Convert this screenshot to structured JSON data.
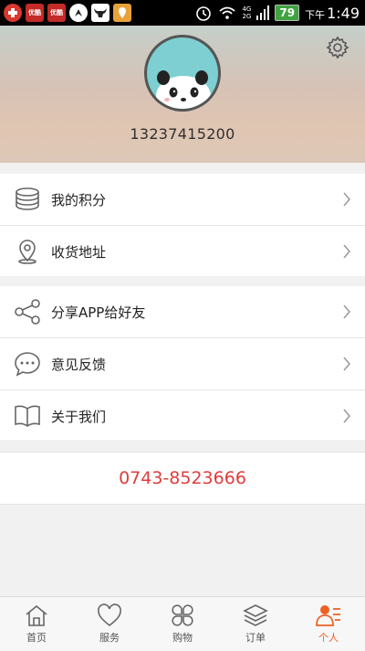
{
  "status_bar": {
    "apps": [
      {
        "icon": "plus-circle-icon",
        "color": "#d9382f"
      },
      {
        "icon": "youku-icon",
        "color": "#c22b27",
        "text": "优酷"
      },
      {
        "icon": "youku-icon",
        "color": "#c22b27",
        "text": "优酷"
      },
      {
        "icon": "compass-icon",
        "color": "#222222"
      },
      {
        "icon": "bull-icon",
        "color": "#222222"
      },
      {
        "icon": "map-pin-icon",
        "color": "#e8a23a"
      }
    ],
    "network": "4G\n2G",
    "battery": "79",
    "time_prefix": "下午",
    "time": "1:49"
  },
  "profile": {
    "phone": "13237415200",
    "avatar_icon": "panda-avatar-icon",
    "settings_icon": "gear-icon"
  },
  "menu_group_1": [
    {
      "label": "我的积分",
      "icon": "coins-icon"
    },
    {
      "label": "收货地址",
      "icon": "location-pin-icon"
    }
  ],
  "menu_group_2": [
    {
      "label": "分享APP给好友",
      "icon": "share-icon"
    },
    {
      "label": "意见反馈",
      "icon": "chat-bubble-icon"
    },
    {
      "label": "关于我们",
      "icon": "book-icon"
    }
  ],
  "contact": {
    "phone": "0743-8523666"
  },
  "tabs": [
    {
      "label": "首页",
      "icon": "home-icon"
    },
    {
      "label": "服务",
      "icon": "heart-icon"
    },
    {
      "label": "购物",
      "icon": "clover-icon"
    },
    {
      "label": "订单",
      "icon": "layers-icon"
    },
    {
      "label": "个人",
      "icon": "person-icon",
      "active": true
    }
  ],
  "colors": {
    "accent": "#f06022",
    "phone_red": "#e03c3c"
  }
}
